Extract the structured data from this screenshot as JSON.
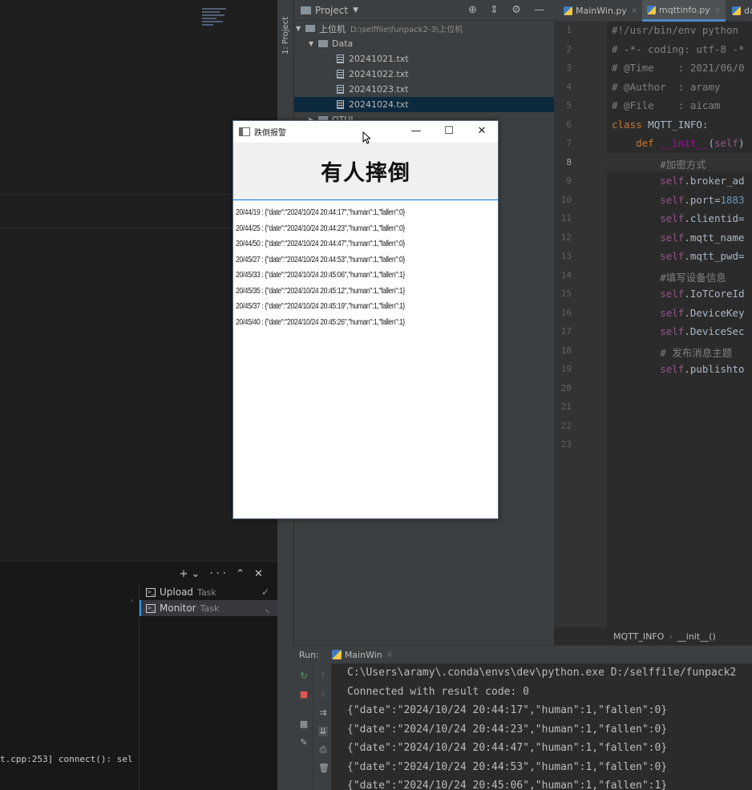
{
  "left_pane": {
    "terminal_actions": "+⌄ ··· ⌃ ✕",
    "tasks": [
      {
        "label": "Upload",
        "kind": "Task",
        "status": "✓"
      },
      {
        "label": "Monitor",
        "kind": "Task",
        "status": "◟"
      }
    ],
    "terminal_line": "t.cpp:253] connect(): sel"
  },
  "sidebar": {
    "project_label": "1: Project"
  },
  "project": {
    "header": "Project",
    "tree": [
      {
        "name": "上位机",
        "path": "D:\\selffile\\funpack2-3\\上位机",
        "type": "folder"
      },
      {
        "name": "Data",
        "type": "folder"
      },
      {
        "name": "20241021.txt",
        "type": "file"
      },
      {
        "name": "20241022.txt",
        "type": "file"
      },
      {
        "name": "20241023.txt",
        "type": "file"
      },
      {
        "name": "20241024.txt",
        "type": "file",
        "selected": true
      },
      {
        "name": "OTUI",
        "type": "folder"
      }
    ]
  },
  "editor": {
    "tabs": [
      {
        "label": "MainWin.py",
        "active": false
      },
      {
        "label": "mqttinfo.py",
        "active": true
      },
      {
        "label": "da",
        "active": false
      }
    ],
    "line_numbers": [
      "1",
      "2",
      "3",
      "4",
      "5",
      "6",
      "7",
      "8",
      "9",
      "10",
      "11",
      "12",
      "13",
      "14",
      "15",
      "16",
      "17",
      "18",
      "19",
      "20",
      "21",
      "22",
      "23"
    ],
    "current_line": "8",
    "code": [
      "#!/usr/bin/env python",
      "# -*- coding: utf-8 -*",
      "# @Time    : 2021/06/0",
      "# @Author  : aramy",
      "# @File    : aicam",
      "class MQTT_INFO:",
      "    def __init__(self)",
      "        #加密方式",
      "        self.broker_ad",
      "        self.port=1883",
      "        self.clientid=",
      "        self.mqtt_name",
      "        self.mqtt_pwd=",
      "        #填写设备信息",
      "        self.IoTCoreId",
      "        self.DeviceKey",
      "        self.DeviceSec",
      "        # 发布消息主题",
      "        self.publishto"
    ],
    "breadcrumb": [
      "MQTT_INFO",
      "__init__()"
    ]
  },
  "run": {
    "label": "Run:",
    "tab": "MainWin",
    "console": [
      "C:\\Users\\aramy\\.conda\\envs\\dev\\python.exe D:/selffile/funpack2",
      "Connected with result code: 0",
      "{\"date\":\"2024/10/24 20:44:17\",\"human\":1,\"fallen\":0}",
      "{\"date\":\"2024/10/24 20:44:23\",\"human\":1,\"fallen\":0}",
      "{\"date\":\"2024/10/24 20:44:47\",\"human\":1,\"fallen\":0}",
      "{\"date\":\"2024/10/24 20:44:53\",\"human\":1,\"fallen\":0}",
      "{\"date\":\"2024/10/24 20:45:06\",\"human\":1,\"fallen\":1}"
    ]
  },
  "app": {
    "title": "跌倒报警",
    "header": "有人摔倒",
    "log": [
      "20/44/19 : {\"date\":\"2024/10/24 20:44:17\",\"human\":1,\"fallen\":0}",
      "20/44/25 : {\"date\":\"2024/10/24 20:44:23\",\"human\":1,\"fallen\":0}",
      "20/44/50 : {\"date\":\"2024/10/24 20:44:47\",\"human\":1,\"fallen\":0}",
      "20/45/27 : {\"date\":\"2024/10/24 20:44:53\",\"human\":1,\"fallen\":0}",
      "20/45/33 : {\"date\":\"2024/10/24 20:45:06\",\"human\":1,\"fallen\":1}",
      "20/45/35 : {\"date\":\"2024/10/24 20:45:12\",\"human\":1,\"fallen\":1}",
      "20/45/37 : {\"date\":\"2024/10/24 20:45:19\",\"human\":1,\"fallen\":1}",
      "20/45/40 : {\"date\":\"2024/10/24 20:45:26\",\"human\":1,\"fallen\":1}"
    ]
  },
  "colors": {
    "comment": "#808080",
    "keyword": "#cc7832",
    "self": "#94558d",
    "number": "#6897bb",
    "function": "#ffc66d",
    "class_name": "#a9b7c6",
    "accent": "#0078d7"
  }
}
